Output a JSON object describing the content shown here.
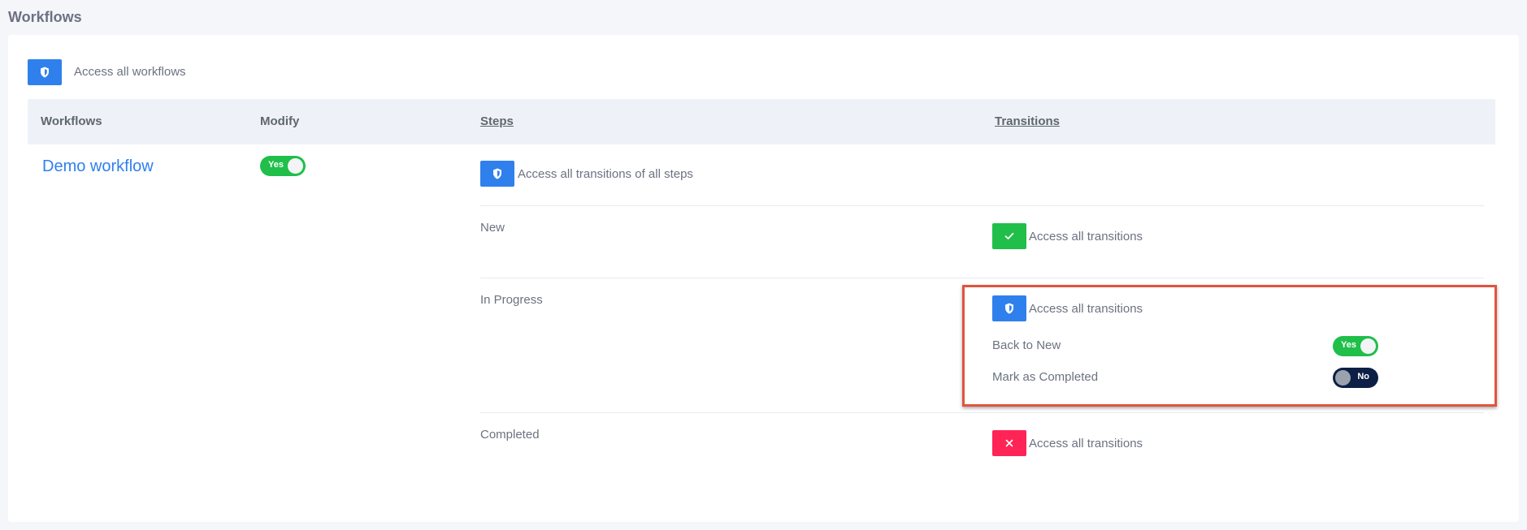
{
  "page": {
    "title": "Workflows"
  },
  "access_all_workflows": {
    "label": "Access all workflows",
    "icon": "shield-icon",
    "color": "#2f80ed"
  },
  "table": {
    "headers": {
      "workflows": "Workflows",
      "modify": "Modify",
      "steps": "Steps",
      "transitions": "Transitions"
    },
    "workflow": {
      "name": "Demo workflow",
      "modify_toggle": {
        "state": "on",
        "label": "Yes"
      },
      "all_steps": {
        "label": "Access all transitions of all steps",
        "icon": "shield-icon"
      },
      "steps": [
        {
          "name": "New",
          "access": {
            "label": "Access all transitions",
            "icon": "check-icon",
            "color": "#1fbf4a"
          },
          "transitions": []
        },
        {
          "name": "In Progress",
          "access": {
            "label": "Access all transitions",
            "icon": "shield-icon",
            "color": "#2f80ed"
          },
          "transitions": [
            {
              "name": "Back to New",
              "toggle": {
                "state": "on",
                "label": "Yes"
              }
            },
            {
              "name": "Mark as Completed",
              "toggle": {
                "state": "off",
                "label": "No"
              }
            }
          ]
        },
        {
          "name": "Completed",
          "access": {
            "label": "Access all transitions",
            "icon": "close-icon",
            "color": "#ff2456"
          },
          "transitions": []
        }
      ]
    }
  },
  "colors": {
    "highlight_border": "#e0543e",
    "link": "#2f80ed",
    "toggle_on": "#1fbf4a",
    "toggle_off": "#0e1f45"
  }
}
